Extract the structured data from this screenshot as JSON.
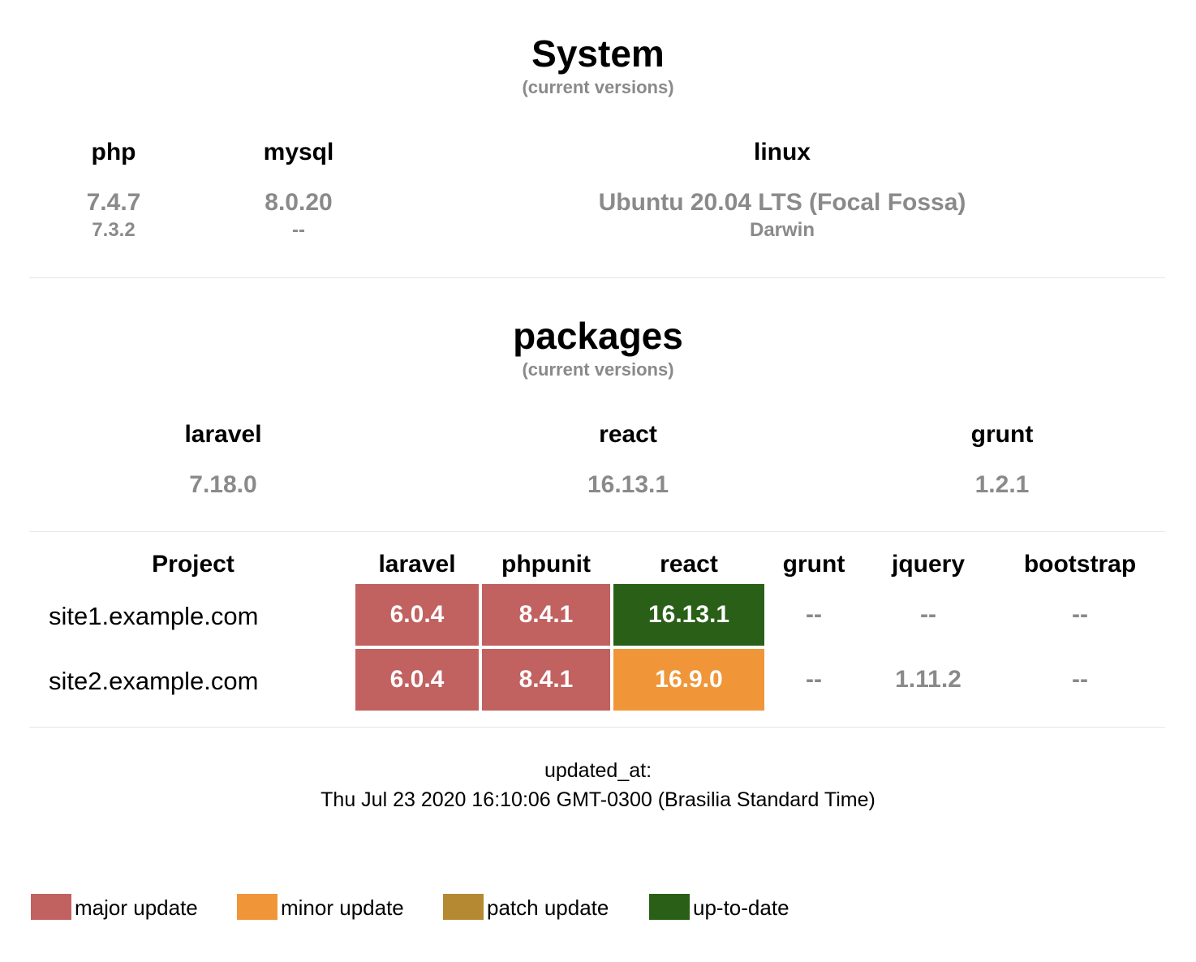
{
  "system": {
    "title": "System",
    "subtitle": "(current versions)",
    "columns": [
      {
        "name": "php",
        "value": "7.4.7",
        "secondary": "7.3.2"
      },
      {
        "name": "mysql",
        "value": "8.0.20",
        "secondary": "--"
      },
      {
        "name": "linux",
        "value": "Ubuntu 20.04 LTS (Focal Fossa)",
        "secondary": "Darwin"
      }
    ]
  },
  "packages": {
    "title": "packages",
    "subtitle": "(current versions)",
    "columns": [
      {
        "name": "laravel",
        "value": "7.18.0"
      },
      {
        "name": "react",
        "value": "16.13.1"
      },
      {
        "name": "grunt",
        "value": "1.2.1"
      }
    ]
  },
  "projects_table": {
    "headers": [
      "Project",
      "laravel",
      "phpunit",
      "react",
      "grunt",
      "jquery",
      "bootstrap"
    ],
    "rows": [
      {
        "project": "site1.example.com",
        "laravel": "6.0.4",
        "phpunit": "8.4.1",
        "react": "16.13.1",
        "grunt": "--",
        "jquery": "--",
        "bootstrap": "--",
        "status": {
          "laravel": "major",
          "phpunit": "major",
          "react": "up-to-date"
        }
      },
      {
        "project": "site2.example.com",
        "laravel": "6.0.4",
        "phpunit": "8.4.1",
        "react": "16.9.0",
        "grunt": "--",
        "jquery": "1.11.2",
        "bootstrap": "--",
        "status": {
          "laravel": "major",
          "phpunit": "major",
          "react": "minor"
        }
      }
    ]
  },
  "updated": {
    "label": "updated_at:",
    "value": "Thu Jul 23 2020 16:10:06 GMT-0300 (Brasilia Standard Time)"
  },
  "legend": [
    {
      "label": "major update",
      "color": "#c16160"
    },
    {
      "label": "minor update",
      "color": "#f09638"
    },
    {
      "label": "patch update",
      "color": "#b48931"
    },
    {
      "label": "up-to-date",
      "color": "#2a5f18"
    }
  ],
  "colors": {
    "major": "#c16160",
    "minor": "#f09638",
    "patch": "#b48931",
    "up-to-date": "#2a5f18",
    "muted_text": "#8a8a8a"
  }
}
